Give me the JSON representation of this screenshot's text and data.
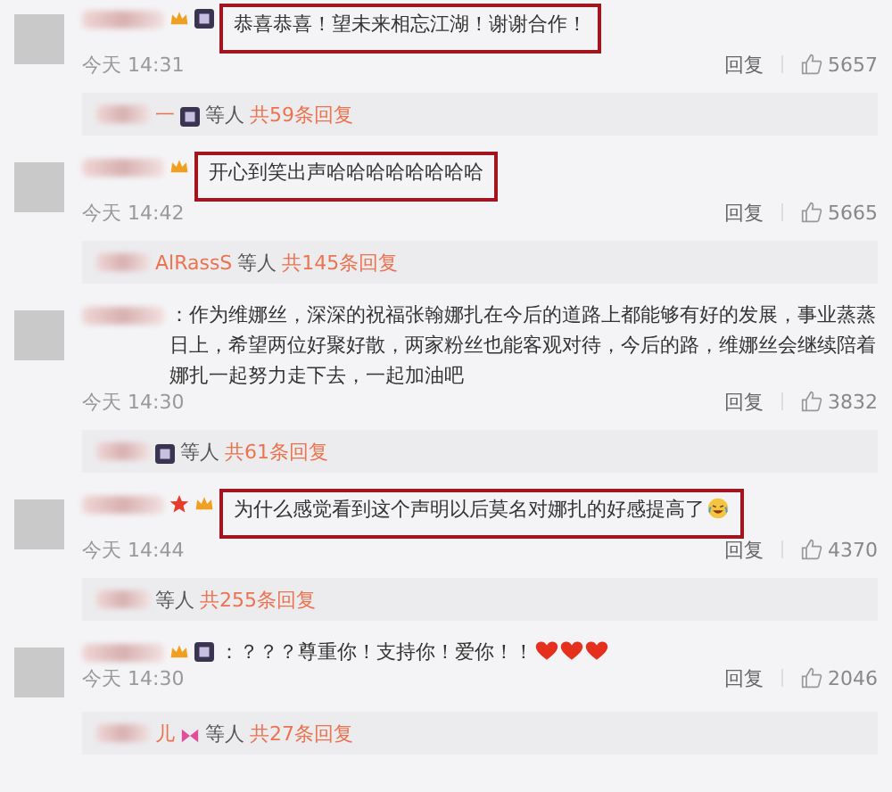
{
  "comments": [
    {
      "text": "恭喜恭喜！望未来相忘江湖！谢谢合作！",
      "highlighted": true,
      "badges": [
        {
          "kind": "crown"
        },
        {
          "kind": "vip"
        }
      ],
      "time": "今天 14:31",
      "reply_label": "回复",
      "likes": "5657",
      "replies": {
        "name": "一",
        "badges": [
          {
            "kind": "vip"
          }
        ],
        "others": "等人",
        "count": "共59条回复"
      }
    },
    {
      "text": "开心到笑出声哈哈哈哈哈哈哈哈",
      "highlighted": true,
      "badges": [
        {
          "kind": "crown"
        }
      ],
      "time": "今天 14:42",
      "reply_label": "回复",
      "likes": "5665",
      "replies": {
        "name": "AlRassS",
        "others": "等人",
        "count": "共145条回复"
      }
    },
    {
      "text": "：作为维娜丝，深深的祝福张翰娜扎在今后的道路上都能够有好的发展，事业蒸蒸日上，希望两位好聚好散，两家粉丝也能客观对待，今后的路，维娜丝会继续陪着娜扎一起努力走下去，一起加油吧",
      "highlighted": false,
      "time": "今天 14:30",
      "reply_label": "回复",
      "likes": "3832",
      "replies": {
        "badges": [
          {
            "kind": "vip"
          }
        ],
        "others": "等人",
        "count": "共61条回复"
      }
    },
    {
      "text": "为什么感觉看到这个声明以后莫名对娜扎的好感提高了",
      "highlighted": true,
      "badges": [
        {
          "kind": "star"
        },
        {
          "kind": "crown"
        }
      ],
      "trailing_icons": [
        {
          "kind": "laugh-cry"
        }
      ],
      "time": "今天 14:44",
      "reply_label": "回复",
      "likes": "4370",
      "replies": {
        "others": "等人",
        "count": "共255条回复"
      }
    },
    {
      "text": "：？？？尊重你！支持你！爱你！！",
      "highlighted": false,
      "badges": [
        {
          "kind": "crown"
        },
        {
          "kind": "vip"
        }
      ],
      "trailing_icons": [
        {
          "kind": "heart"
        },
        {
          "kind": "heart"
        },
        {
          "kind": "heart"
        }
      ],
      "time": "今天 14:30",
      "reply_label": "回复",
      "likes": "2046",
      "replies": {
        "name": "儿",
        "badges": [
          {
            "kind": "bow"
          }
        ],
        "others": "等人",
        "count": "共27条回复"
      }
    }
  ]
}
